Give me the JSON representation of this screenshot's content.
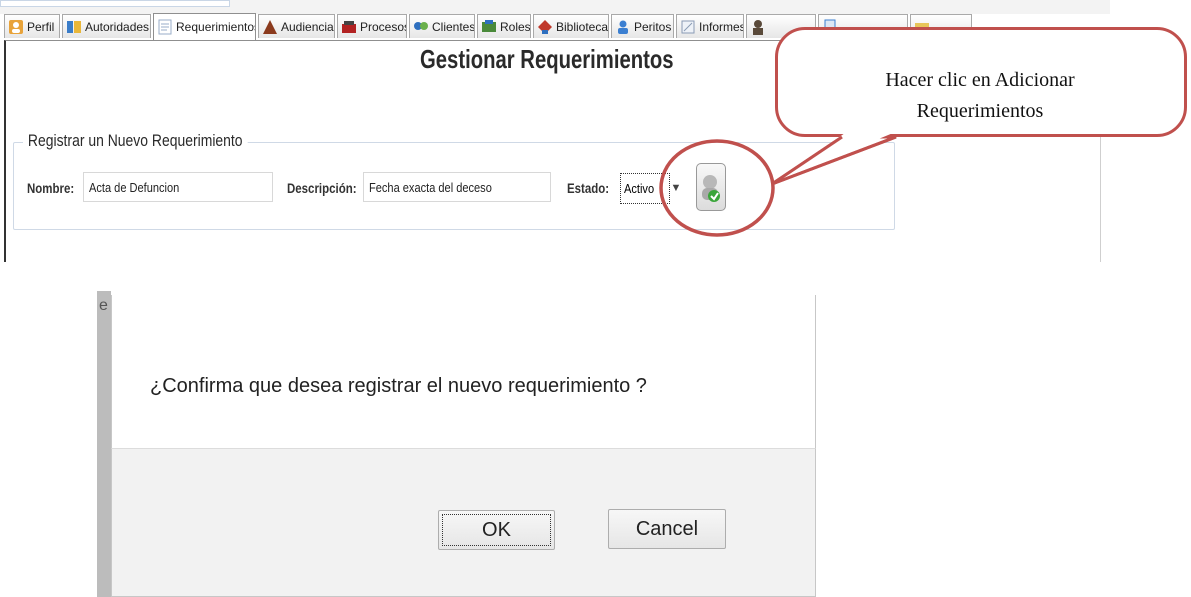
{
  "tabs": [
    {
      "label": "Perfil",
      "icon": "profile-icon",
      "color": "#e8a33a"
    },
    {
      "label": "Autoridades",
      "icon": "authorities-icon",
      "color": "#3a7dc9"
    },
    {
      "label": "Requerimientos",
      "icon": "requirements-icon",
      "color": "#9aaec8",
      "active": true
    },
    {
      "label": "Audiencias",
      "icon": "hearings-icon",
      "color": "#8b3a1d"
    },
    {
      "label": "Procesos",
      "icon": "processes-icon",
      "color": "#b22222"
    },
    {
      "label": "Clientes",
      "icon": "clients-icon",
      "color": "#2e6fbf"
    },
    {
      "label": "Roles",
      "icon": "roles-icon",
      "color": "#4a8a3a"
    },
    {
      "label": "Biblioteca",
      "icon": "library-icon",
      "color": "#c0392b"
    },
    {
      "label": "Peritos",
      "icon": "experts-icon",
      "color": "#3b7fd1"
    },
    {
      "label": "Informes",
      "icon": "reports-icon",
      "color": "#8a9bb5"
    }
  ],
  "page": {
    "title": "Gestionar Requerimientos",
    "legend": "Registrar un Nuevo Requerimiento"
  },
  "form": {
    "nombre_label": "Nombre:",
    "nombre_value": "Acta de Defuncion",
    "descripcion_label": "Descripción:",
    "descripcion_value": "Fecha exacta del deceso",
    "estado_label": "Estado:",
    "estado_value": "Activo",
    "add_button_icon": "add-user-icon"
  },
  "callout": {
    "line1": "Hacer clic en Adicionar",
    "line2": "Requerimientos",
    "color": "#c0504d"
  },
  "dialog": {
    "message": "¿Confirma que desea registrar el nuevo requerimiento ?",
    "ok_label": "OK",
    "cancel_label": "Cancel",
    "edge_fragment": "e"
  }
}
